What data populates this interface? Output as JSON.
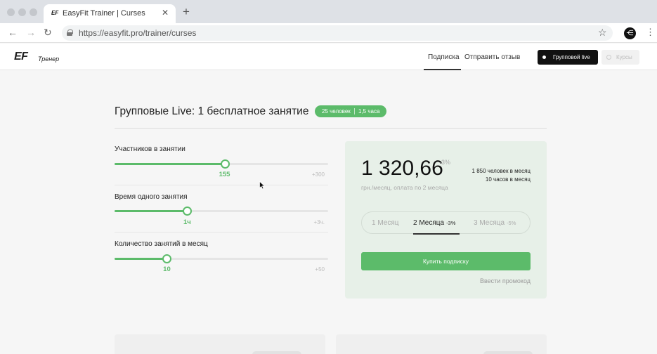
{
  "browser": {
    "tab_title": "EasyFit Trainer | Curses",
    "tab_favicon": "EF",
    "url": "https://easyfit.pro/trainer/curses",
    "icons": [
      "back-arrow-icon",
      "forward-arrow-icon",
      "reload-icon",
      "lock-icon",
      "star-icon",
      "menu-dots-icon"
    ]
  },
  "header": {
    "logo": "EF",
    "logo_sub": "Тренер",
    "nav": {
      "subscription": "Подписка",
      "feedback": "Отправить отзыв"
    },
    "group_live_button": "Групповой live",
    "courses_button": "Курсы"
  },
  "main": {
    "title": "Групповые Live: 1 бесплатное занятие",
    "badge_people": "25 человек",
    "badge_hours": "1,5 часа",
    "sliders": [
      {
        "label": "Участников в занятии",
        "value": "155",
        "max": "+300",
        "level": 0.515
      },
      {
        "label": "Время одного занятия",
        "value": "1ч",
        "max": "+3ч.",
        "level": 0.34
      },
      {
        "label": "Количество занятий в месяц",
        "value": "10",
        "max": "+50",
        "level": 0.245
      }
    ]
  },
  "pricing": {
    "price": "1 320,66",
    "discount": "-3%",
    "subtitle": "грн./месяц, оплата по 2 месяца",
    "people_per_month": "1 850 человек в месяц",
    "hours_per_month": "10 часов в месяц",
    "periods": {
      "one": {
        "label": "1 Месяц"
      },
      "two": {
        "label": "2 Месяца",
        "discount": "-3%"
      },
      "three": {
        "label": "3 Месяца",
        "discount": "-5%"
      }
    },
    "buy_button": "Купить подписку",
    "promo_link": "Ввести промокод"
  },
  "colors": {
    "accent": "#5cbb6a",
    "card_bg": "#e7f0e8",
    "page_bg": "#f6f6f6"
  }
}
